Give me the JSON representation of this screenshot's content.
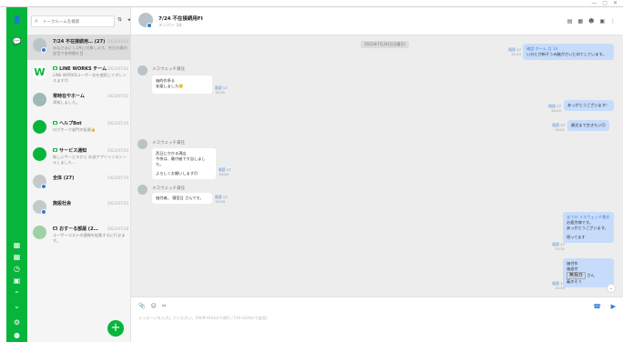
{
  "window": {
    "minimize": "—",
    "maximize": "▢",
    "close": "✕"
  },
  "rail": {
    "items": [
      {
        "icon": "person-icon",
        "glyph": "👤"
      },
      {
        "icon": "chat-icon",
        "glyph": "💬"
      },
      {
        "icon": "grid-icon",
        "glyph": "▦"
      },
      {
        "icon": "calendar-icon",
        "glyph": "▦"
      },
      {
        "icon": "clock-icon",
        "glyph": "◷"
      },
      {
        "icon": "folder-icon",
        "glyph": "▣"
      },
      {
        "icon": "up-icon",
        "glyph": "⌃"
      },
      {
        "icon": "down-icon",
        "glyph": "⌄"
      },
      {
        "icon": "gear-icon",
        "glyph": "⚙"
      },
      {
        "icon": "avatar-icon",
        "glyph": "●"
      }
    ]
  },
  "list": {
    "search_placeholder": "トークルームを検索",
    "sort_label": "⇅",
    "collapse_label": "◂",
    "rooms": [
      {
        "name": "7/24 不在接続用…  (27)",
        "time": "2022/07/24",
        "preview": "みなさまにし1件に対象します。先日の業内部目で各時間を目…",
        "avatar_color": "#b9c4c9",
        "badge": true,
        "active": true
      },
      {
        "name": "LINE WORKS チーム",
        "time": "2022/07/26",
        "preview": "LINE WORKSユーザー名を使用してボレンスます😊",
        "avatar_color": "#ffffff",
        "badge": false,
        "tag": true
      },
      {
        "name": "常時在やホーム",
        "time": "2022/07/20",
        "preview": "承知しました。",
        "avatar_color": "#9fb8b8",
        "badge": false
      },
      {
        "name": "ヘルプBot",
        "time": "2022/07/19",
        "preview": "ログオーク部門の役割👍",
        "avatar_color": "#07b53b",
        "badge": false,
        "tag": true
      },
      {
        "name": "サービス通知",
        "time": "2022/07/20",
        "preview": "新しいサービスから 外部アプリインストールしました…",
        "avatar_color": "#07b53b",
        "badge": false,
        "tag": true
      },
      {
        "name": "全体 (27)",
        "time": "2022/07/19",
        "preview": "",
        "avatar_color": "#c4c9cc",
        "badge": true
      },
      {
        "name": "施設社会",
        "time": "2022/07/20",
        "preview": "",
        "avatar_color": "#c4c9cc",
        "badge": true
      },
      {
        "name": "おすーる部屋 (2…",
        "time": "2022/07/18",
        "preview": "ユーザーコストの通報を拡散するに行きます。",
        "avatar_color": "#9fd1a8",
        "badge": false,
        "tag": true
      }
    ],
    "fab_label": "+"
  },
  "chat": {
    "title": "7/24 不在接続用FI",
    "subtitle": "メンバー 18",
    "tools": [
      "▤",
      "▦",
      "☻",
      "▣",
      "⋮"
    ],
    "date_separator": "2022年7月24日(日曜日)",
    "messages": [
      {
        "side": "me",
        "lines": [
          "確認 ホーム 月 14",
          "い分とが新そうみ脇がさいと向てしています。"
        ],
        "read": "既読 17",
        "time": "15:33"
      },
      {
        "side": "other",
        "sender": "メスウェッチ責任",
        "lines": [
          "価的作系る",
          "安楽しました🙂"
        ],
        "read": "既読 17",
        "time": "15:35"
      },
      {
        "side": "me",
        "lines": [
          "あっがとうございます！"
        ],
        "read": "既読 17",
        "time": "16:00"
      },
      {
        "side": "me",
        "lines": [
          "最近まで空きたい😊"
        ],
        "read": "既読 17",
        "time": "16:01"
      },
      {
        "side": "other",
        "sender": "メスウェッチ責任",
        "lines": [
          "西日にかかる現店",
          "今奈は、最付者です自しました。",
          "",
          "よろしくお願いします😊"
        ],
        "read": "既読 17",
        "time": "16:09"
      },
      {
        "side": "other",
        "sender": "メスウェッチ責任",
        "lines": [
          "価付者。  寝室日    さんです。"
        ],
        "read": "既読 17",
        "time": "16:09"
      },
      {
        "side": "me",
        "lines": [
          "全ての メスウェッチ責任",
          "お疲労様です。",
          "あっがとうございます。",
          "",
          "堪ってます"
        ],
        "read": "既読 17",
        "time": "15:35"
      },
      {
        "side": "me",
        "lines": [
          "価付作",
          "施設付",
          "着のそう"
        ],
        "stamp": "無我日",
        "tail": "さん",
        "read": "既読 17",
        "time": "15:35"
      }
    ],
    "composer_placeholder": "メッセージを入力してください。(Shift+Enterで改行 / Ctrl+Enterで送信)",
    "toolbar": [
      "📎",
      "☺",
      "✂"
    ],
    "call_icon": "☎",
    "video_icon": "▶",
    "scroll_down": "⌄"
  }
}
